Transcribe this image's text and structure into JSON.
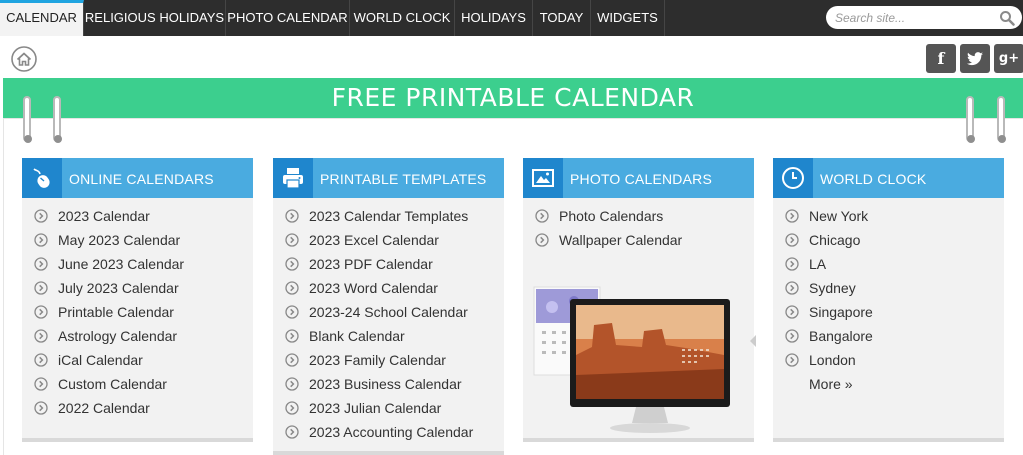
{
  "nav": {
    "items": [
      {
        "label": "CALENDAR",
        "active": true
      },
      {
        "label": "RELIGIOUS HOLIDAYS",
        "active": false
      },
      {
        "label": "PHOTO CALENDAR",
        "active": false
      },
      {
        "label": "WORLD CLOCK",
        "active": false
      },
      {
        "label": "HOLIDAYS",
        "active": false
      },
      {
        "label": "TODAY",
        "active": false
      },
      {
        "label": "WIDGETS",
        "active": false
      }
    ],
    "search_placeholder": "Search site..."
  },
  "social": [
    {
      "label": "f",
      "icon": "facebook-icon"
    },
    {
      "label": "t",
      "icon": "twitter-icon"
    },
    {
      "label": "g+",
      "icon": "google-plus-icon"
    }
  ],
  "banner": {
    "title": "FREE PRINTABLE CALENDAR"
  },
  "colors": {
    "nav_bg": "#2d2d2d",
    "banner": "#3ccf8e",
    "card_header": "#4aabe0",
    "card_icon_bg": "#1f86cd",
    "card_bg": "#f2f2f2"
  },
  "cards": [
    {
      "title": "ONLINE CALENDARS",
      "icon": "mouse-icon",
      "items": [
        "2023 Calendar",
        "May 2023 Calendar",
        "June 2023 Calendar",
        "July 2023 Calendar",
        "Printable Calendar",
        "Astrology Calendar",
        "iCal Calendar",
        "Custom Calendar",
        "2022 Calendar"
      ]
    },
    {
      "title": "PRINTABLE TEMPLATES",
      "icon": "printer-icon",
      "items": [
        "2023 Calendar Templates",
        "2023 Excel Calendar",
        "2023 PDF Calendar",
        "2023 Word Calendar",
        "2023-24 School Calendar",
        "Blank Calendar",
        "2023 Family Calendar",
        "2023 Business Calendar",
        "2023 Julian Calendar",
        "2023 Accounting Calendar"
      ]
    },
    {
      "title": "PHOTO CALENDARS",
      "icon": "photo-icon",
      "items": [
        "Photo Calendars",
        "Wallpaper Calendar"
      ]
    },
    {
      "title": "WORLD CLOCK",
      "icon": "clock-icon",
      "items": [
        "New York",
        "Chicago",
        "LA",
        "Sydney",
        "Singapore",
        "Bangalore",
        "London"
      ],
      "more": "More »"
    }
  ]
}
